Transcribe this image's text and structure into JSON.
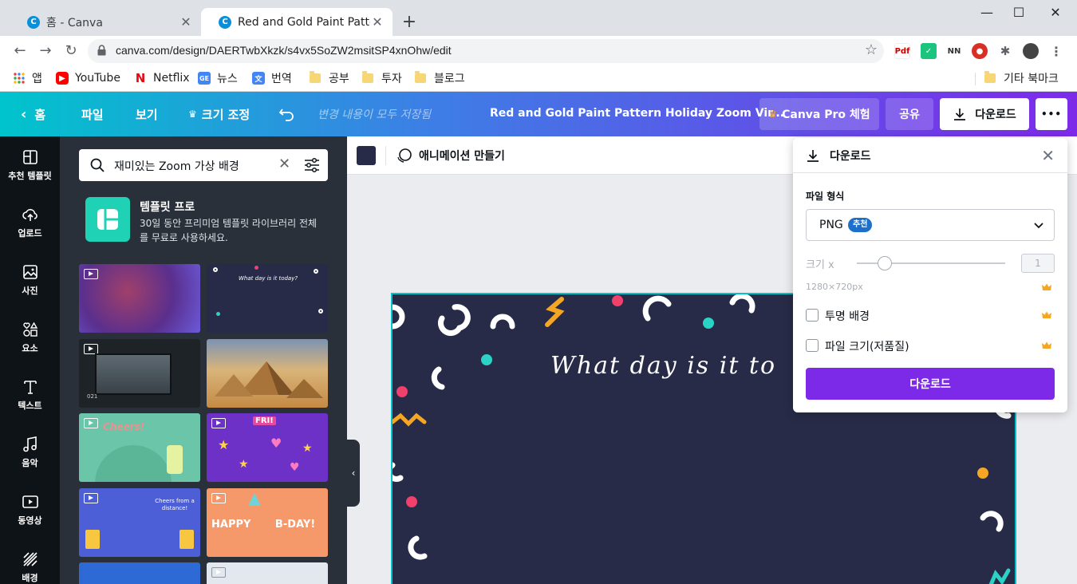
{
  "browser": {
    "tabs": [
      {
        "title": "홈 - Canva",
        "favicon": "C"
      },
      {
        "title": "Red and Gold Paint Pattern",
        "favicon": "C"
      }
    ],
    "url": "canva.com/design/DAERTwbXkzk/s4vx5SoZW2msitSP4xnOhw/edit",
    "bookmarks": [
      {
        "label": "앱",
        "icon": "apps-grid-icon"
      },
      {
        "label": "YouTube",
        "icon": "youtube-icon"
      },
      {
        "label": "Netflix",
        "icon": "netflix-icon"
      },
      {
        "label": "뉴스",
        "icon": "google-news-icon"
      },
      {
        "label": "번역",
        "icon": "translate-icon"
      },
      {
        "label": "공부",
        "icon": "folder-icon"
      },
      {
        "label": "투자",
        "icon": "folder-icon"
      },
      {
        "label": "블로그",
        "icon": "folder-icon"
      }
    ],
    "other_bookmarks": "기타 북마크"
  },
  "canva_header": {
    "home": "홈",
    "file": "파일",
    "view": "보기",
    "resize": "크기 조정",
    "saved_status": "변경 내용이 모두 저장됨",
    "doc_title": "Red and Gold Paint Pattern Holiday Zoom Vir...",
    "pro_trial": "Canva Pro 체험",
    "share": "공유",
    "download": "다운로드",
    "more": "•••"
  },
  "rail": [
    {
      "label": "추천 템플릿",
      "icon": "template-icon"
    },
    {
      "label": "업로드",
      "icon": "upload-cloud-icon"
    },
    {
      "label": "사진",
      "icon": "photo-icon"
    },
    {
      "label": "요소",
      "icon": "elements-icon"
    },
    {
      "label": "텍스트",
      "icon": "text-icon"
    },
    {
      "label": "음악",
      "icon": "music-icon"
    },
    {
      "label": "동영상",
      "icon": "video-icon"
    },
    {
      "label": "배경",
      "icon": "background-icon"
    }
  ],
  "panel": {
    "search_value": "재미있는 Zoom 가상 배경",
    "promo_title": "템플릿 프로",
    "promo_desc": "30일 동안 프리미엄 템플릿 라이브러리 전체를 무료로 사용하세요.",
    "thumbs": [
      {
        "caption": ""
      },
      {
        "caption": "What day is it today?"
      },
      {
        "caption": "021"
      },
      {
        "caption": ""
      },
      {
        "caption": "Cheers!"
      },
      {
        "caption": "FRI!"
      },
      {
        "caption": "Cheers from a distance!"
      },
      {
        "caption": "HAPPY B-DAY!"
      }
    ]
  },
  "context_bar": {
    "animate": "애니메이션 만들기"
  },
  "canvas": {
    "headline": "What day is it to"
  },
  "download_panel": {
    "title": "다운로드",
    "file_type_label": "파일 형식",
    "file_type_value": "PNG",
    "recommended_badge": "추천",
    "size_label": "크기 x",
    "size_value": "1",
    "dimensions": "1280×720px",
    "transparent_bg": "투명 배경",
    "compress": "파일 크기(저품질)",
    "download_button": "다운로드"
  },
  "colors": {
    "canva_purple": "#7d2ae8",
    "canva_teal": "#00c4cc",
    "canvas_bg": "#272b48",
    "pro_crown": "#f5a623"
  }
}
